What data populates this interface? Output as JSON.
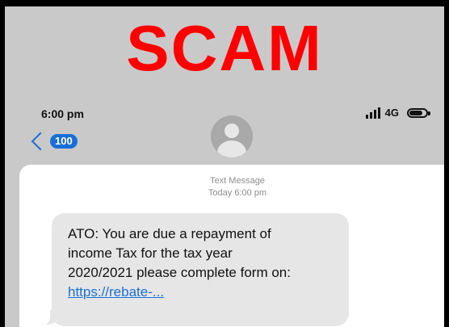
{
  "overlay": {
    "title": "SCAM"
  },
  "status_bar": {
    "time": "6:00 pm",
    "network": "4G"
  },
  "header": {
    "back_count": "100"
  },
  "thread": {
    "label": "Text Message",
    "timestamp": "Today 6:00 pm"
  },
  "message": {
    "lines": [
      "ATO: You are due a repayment of",
      "income Tax for the tax year",
      "2020/2021 please complete form on:"
    ],
    "link": "https://rebate-..."
  },
  "colors": {
    "scam_red": "#ff0000",
    "link_blue": "#1a6fd6"
  },
  "icons": {
    "back": "chevron-left-icon",
    "avatar": "contact-avatar-icon",
    "signal": "signal-bars-icon",
    "battery": "battery-icon"
  }
}
